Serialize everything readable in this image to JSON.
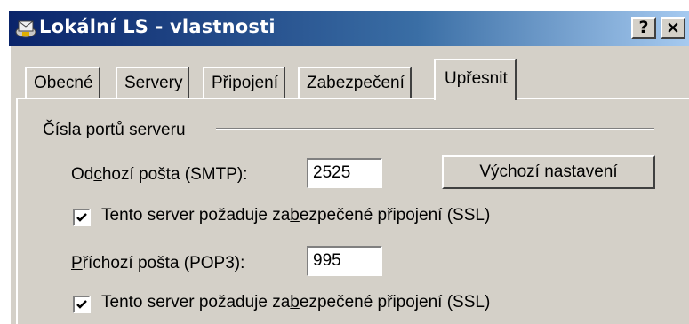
{
  "window": {
    "title": "Lokální LS - vlastnosti",
    "help_button": "?",
    "close_button": "×"
  },
  "tabs": [
    {
      "label": "Obecné",
      "active": false
    },
    {
      "label": "Servery",
      "active": false
    },
    {
      "label": "Připojení",
      "active": false
    },
    {
      "label": "Zabezpečení",
      "active": false
    },
    {
      "label": "Upřesnit",
      "active": true
    }
  ],
  "ports_group": {
    "title": "Čísla portů serveru",
    "smtp": {
      "label_pre": "Od",
      "label_mnemonic": "c",
      "label_post": "hozí pošta (SMTP):",
      "value": "2525"
    },
    "default_button": {
      "mnemonic": "V",
      "rest": "ýchozí nastavení"
    },
    "smtp_ssl": {
      "checked": true,
      "label_pre": "Tento server požaduje za",
      "label_mnemonic": "b",
      "label_post": "ezpečené připojení (SSL)"
    },
    "pop3": {
      "label_mnemonic": "P",
      "label_post": "říchozí pošta (POP3):",
      "value": "995"
    },
    "pop3_ssl": {
      "checked": true,
      "label_pre": "Tento server požaduje za",
      "label_mnemonic": "b",
      "label_post": "ezpečené připojení (SSL)"
    }
  },
  "colors": {
    "titlebar_start": "#0a246a",
    "titlebar_end": "#a6caf0",
    "face": "#d4d0c8"
  }
}
